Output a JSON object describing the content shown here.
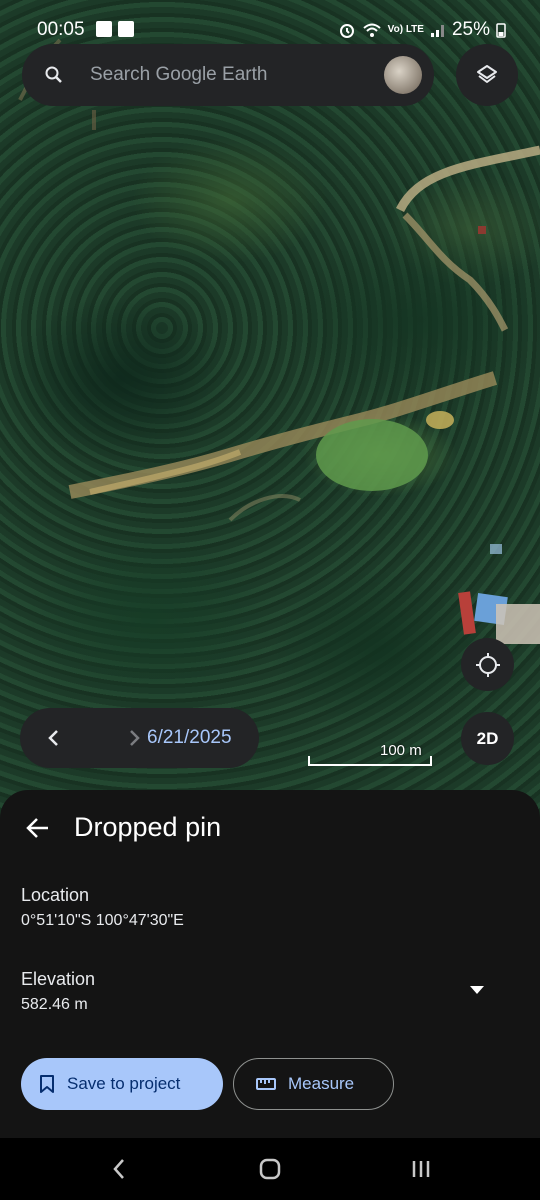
{
  "status_bar": {
    "time": "00:05",
    "battery": "25%",
    "network_badge": "Vo) LTE"
  },
  "search": {
    "placeholder": "Search Google Earth"
  },
  "imagery": {
    "date": "6/21/2025",
    "scale_label": "100 m",
    "view_mode": "2D"
  },
  "sheet": {
    "title": "Dropped pin",
    "location_label": "Location",
    "location_value": "0°51'10\"S 100°47'30\"E",
    "elevation_label": "Elevation",
    "elevation_value": "582.46 m"
  },
  "actions": {
    "save_label": "Save to project",
    "measure_label": "Measure"
  },
  "icons": [
    "search-icon",
    "avatar",
    "layers-icon",
    "my-location-icon",
    "chevron-left-icon",
    "chevron-right-icon",
    "back-arrow-icon",
    "dropdown-arrow-icon",
    "bookmark-icon",
    "ruler-icon",
    "nav-recents-icon",
    "nav-home-icon",
    "nav-back-icon"
  ],
  "colors": {
    "accent": "#a8c7fa",
    "on_accent": "#062e6f",
    "surface": "#232426",
    "sheet_bg": "#141414"
  }
}
